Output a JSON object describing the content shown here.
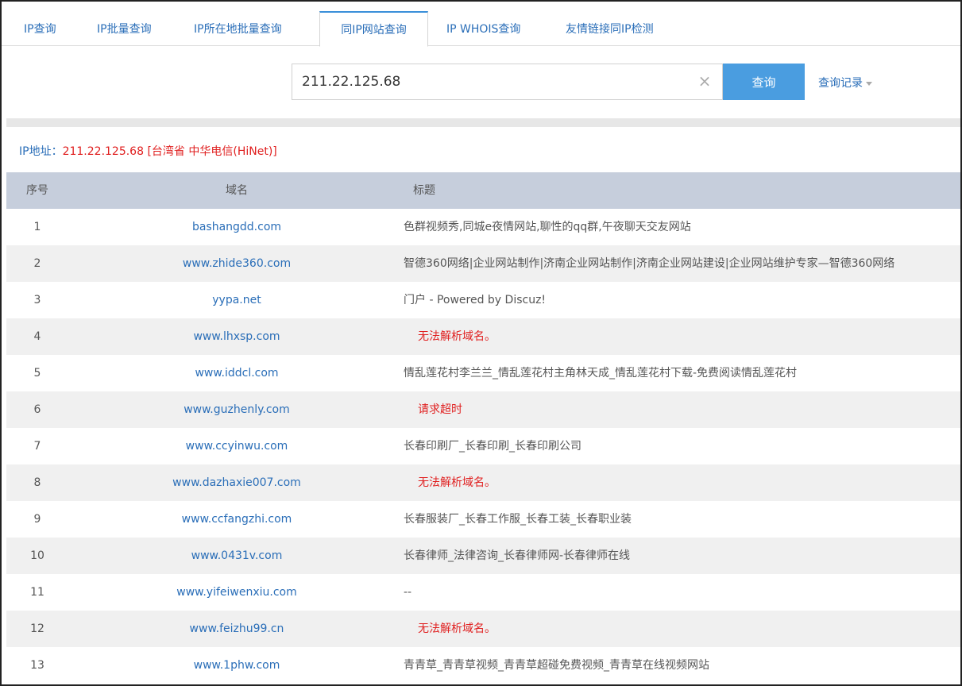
{
  "tabs": [
    {
      "label": "IP查询"
    },
    {
      "label": "IP批量查询"
    },
    {
      "label": "IP所在地批量查询"
    },
    {
      "label": "同IP网站查询",
      "active": true
    },
    {
      "label": "IP WHOIS查询"
    },
    {
      "label": "友情链接同IP检测"
    }
  ],
  "search": {
    "value": "211.22.125.68",
    "button_label": "查询",
    "history_label": "查询记录"
  },
  "ip_info": {
    "label": "IP地址：",
    "value": "211.22.125.68 [台湾省 中华电信(HiNet)]"
  },
  "table": {
    "headers": {
      "no": "序号",
      "domain": "域名",
      "title": "标题"
    },
    "rows": [
      {
        "no": "1",
        "domain": "bashangdd.com",
        "title": "色群视频秀,同城e夜情网站,聊性的qq群,午夜聊天交友网站",
        "error": false
      },
      {
        "no": "2",
        "domain": "www.zhide360.com",
        "title": "智德360网络|企业网站制作|济南企业网站制作|济南企业网站建设|企业网站维护专家—智德360网络",
        "error": false
      },
      {
        "no": "3",
        "domain": "yypa.net",
        "title": "门户 - Powered by Discuz!",
        "error": false
      },
      {
        "no": "4",
        "domain": "www.lhxsp.com",
        "title": "无法解析域名。",
        "error": true
      },
      {
        "no": "5",
        "domain": "www.iddcl.com",
        "title": "情乱莲花村李兰兰_情乱莲花村主角林天成_情乱莲花村下载-免费阅读情乱莲花村",
        "error": false
      },
      {
        "no": "6",
        "domain": "www.guzhenly.com",
        "title": "请求超时",
        "error": true
      },
      {
        "no": "7",
        "domain": "www.ccyinwu.com",
        "title": "长春印刷厂_长春印刷_长春印刷公司",
        "error": false
      },
      {
        "no": "8",
        "domain": "www.dazhaxie007.com",
        "title": "无法解析域名。",
        "error": true
      },
      {
        "no": "9",
        "domain": "www.ccfangzhi.com",
        "title": "长春服装厂_长春工作服_长春工装_长春职业装",
        "error": false
      },
      {
        "no": "10",
        "domain": "www.0431v.com",
        "title": "长春律师_法律咨询_长春律师网-长春律师在线",
        "error": false
      },
      {
        "no": "11",
        "domain": "www.yifeiwenxiu.com",
        "title": "--",
        "error": false
      },
      {
        "no": "12",
        "domain": "www.feizhu99.cn",
        "title": "无法解析域名。",
        "error": true
      },
      {
        "no": "13",
        "domain": "www.1phw.com",
        "title": "青青草_青青草视频_青青草超碰免费视频_青青草在线视频网站",
        "error": false
      }
    ]
  },
  "colors": {
    "link": "#2a6eb8",
    "error": "#e02020",
    "header_bg": "#c6cedc",
    "button_bg": "#4a9de0"
  }
}
